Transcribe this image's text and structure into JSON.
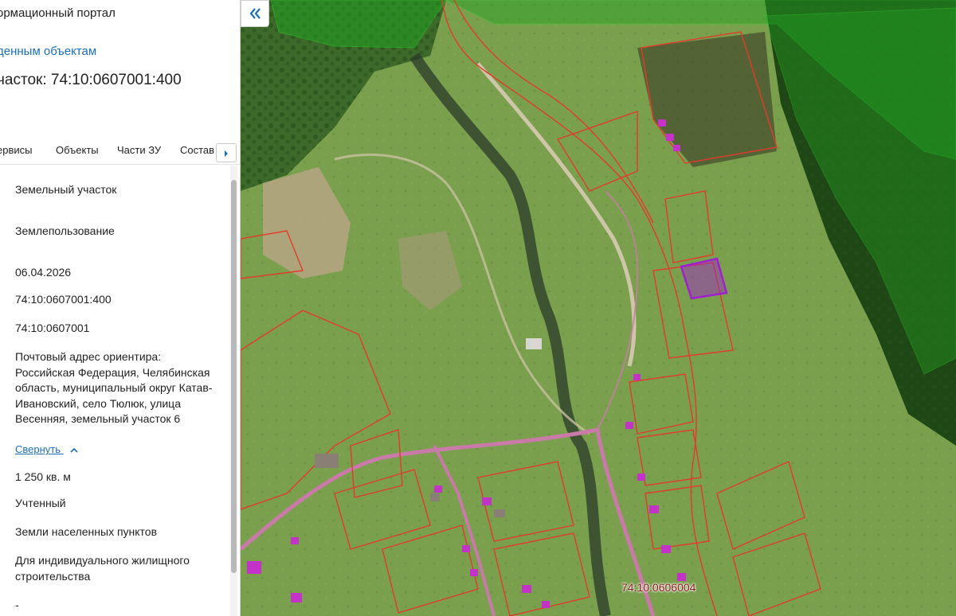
{
  "panel": {
    "portal_title": "ормационный портал",
    "breadcrumb": "денным объектам",
    "title": "часток: 74:10:0607001:400",
    "tabs": [
      "ервисы",
      "Объекты",
      "Части ЗУ",
      "Состав"
    ],
    "fields": {
      "type": "Земельный участок",
      "kind": "Землепользование",
      "date": "06.04.2026",
      "cadastral_number": "74:10:0607001:400",
      "quarter": "74:10:0607001",
      "address": "Почтовый адрес ориентира: Российская Федерация, Челябинская область, муниципальный округ Катав-Ивановский, село Тюлюк, улица Весенняя, земельный участок 6",
      "collapse_label": "Свернуть",
      "area": "1 250 кв. м",
      "status": "Учтенный",
      "category": "Земли населенных пунктов",
      "use": "Для индивидуального жилищного строительства",
      "extra": "-"
    }
  },
  "map": {
    "quarter_label": "74:10:0606004",
    "colors": {
      "parcel_outline": "#e23b2a",
      "selected_parcel": "#a01fd0",
      "forest_overlay": "#22a022",
      "road": "#d4a0c8",
      "building": "#c433c8"
    }
  }
}
